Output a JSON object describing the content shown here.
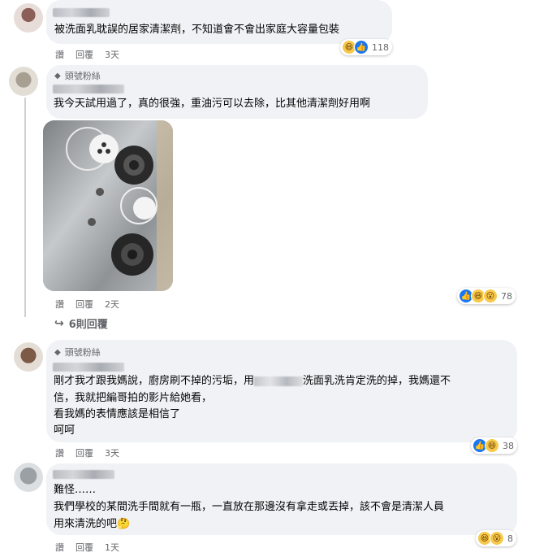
{
  "badge_label": "頭號粉絲",
  "comments": [
    {
      "text": "被洗面乳耽誤的居家清潔劑，不知道會不會出家庭大容量包裝",
      "actions": {
        "like": "讚",
        "reply": "回覆",
        "time": "3天"
      },
      "reactions": {
        "icons": [
          "haha-icon",
          "like-icon"
        ],
        "count": "118"
      }
    },
    {
      "text": "我今天試用過了，真的很強，重油污可以去除，比其他清潔劑好用啊",
      "actions": {
        "like": "讚",
        "reply": "回覆",
        "time": "2天"
      },
      "reactions": {
        "icons": [
          "like-icon",
          "haha-icon",
          "wow-icon"
        ],
        "count": "78"
      },
      "replies_label": "6則回覆"
    },
    {
      "text_line1_a": "剛才我才跟我媽說，廚房刷不掉的污垢，用",
      "text_line1_b": "洗面乳洗肯定洗的掉，我媽還不",
      "text_line2": "信，我就把編哥拍的影片給她看，",
      "text_line3": "看我媽的表情應該是相信了",
      "text_line4": "呵呵",
      "actions": {
        "like": "讚",
        "reply": "回覆",
        "time": "3天"
      },
      "reactions": {
        "icons": [
          "like-icon",
          "haha-icon"
        ],
        "count": "38"
      }
    },
    {
      "text_line1": "難怪……",
      "text_line2": "我們學校的某間洗手間就有一瓶，一直放在那邊沒有拿走或丟掉，該不會是清潔人員",
      "text_line3": "用來清洗的吧🤔",
      "actions": {
        "like": "讚",
        "reply": "回覆",
        "time": "1天"
      },
      "reactions": {
        "icons": [
          "haha-icon",
          "wow-icon"
        ],
        "count": "8"
      }
    }
  ],
  "colors": {
    "bubble": "#f0f2f5",
    "secondary_text": "#65676b",
    "like_blue": "#1877f2",
    "emoji_yellow": "#f7c94a"
  }
}
